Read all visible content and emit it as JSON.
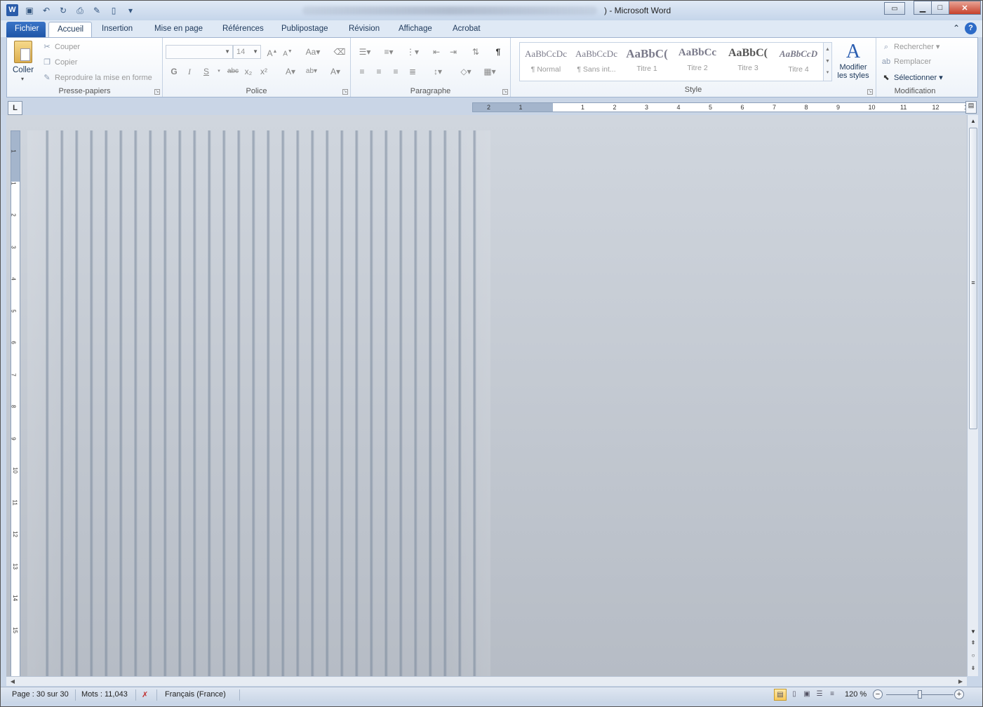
{
  "window": {
    "title": "Microsoft Word",
    "title_prefix": ") -",
    "app_icon": "W"
  },
  "quick_access": [
    "save-icon",
    "undo-icon",
    "redo-icon",
    "print-preview-icon",
    "format-painter-icon",
    "new-document-icon",
    "customize-icon"
  ],
  "tabs": [
    "Fichier",
    "Accueil",
    "Insertion",
    "Mise en page",
    "Références",
    "Publipostage",
    "Révision",
    "Affichage",
    "Acrobat"
  ],
  "active_tab": "Accueil",
  "ribbon": {
    "clipboard": {
      "label": "Presse-papiers",
      "paste": "Coller",
      "cut": "Couper",
      "copy": "Copier",
      "format_painter": "Reproduire la mise en forme"
    },
    "font": {
      "label": "Police",
      "font_name": "",
      "font_size": "14",
      "bold": "G",
      "italic": "I",
      "underline": "S",
      "strike": "abc",
      "subscript": "x₂",
      "superscript": "x²"
    },
    "paragraph": {
      "label": "Paragraphe",
      "pilcrow": "¶"
    },
    "styles": {
      "label": "Style",
      "items": [
        {
          "sample": "AaBbCcDc",
          "name": "¶ Normal"
        },
        {
          "sample": "AaBbCcDc",
          "name": "¶ Sans int..."
        },
        {
          "sample": "AaBbC(",
          "name": "Titre 1"
        },
        {
          "sample": "AaBbCc",
          "name": "Titre 2"
        },
        {
          "sample": "AaBbC(",
          "name": "Titre 3"
        },
        {
          "sample": "AaBbCcD",
          "name": "Titre 4"
        }
      ],
      "modify_line1": "Modifier",
      "modify_line2": "les styles"
    },
    "editing": {
      "label": "Modification",
      "find": "Rechercher",
      "replace": "Remplacer",
      "select": "Sélectionner"
    }
  },
  "ruler": {
    "tab_selector": "L",
    "h_numbers": [
      "2",
      "1",
      "1",
      "2",
      "3",
      "4",
      "5",
      "6",
      "7",
      "8",
      "9",
      "10",
      "11",
      "12",
      "1"
    ],
    "v_numbers": [
      "1",
      "1",
      "2",
      "3",
      "4",
      "5",
      "6",
      "7",
      "8",
      "9",
      "10",
      "11",
      "12",
      "13",
      "14",
      "15"
    ]
  },
  "status": {
    "page": "Page : 30 sur 30",
    "words": "Mots : 11,043",
    "language": "Français (France)",
    "zoom": "120 %",
    "zoom_minus": "−",
    "zoom_plus": "+"
  },
  "colors": {
    "file_tab": "#1f56a8",
    "frame": "#c9d6e8"
  }
}
